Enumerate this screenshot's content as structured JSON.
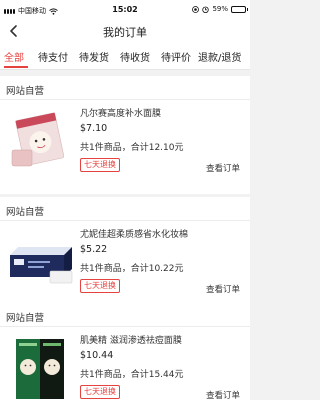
{
  "status_bar": {
    "carrier": "中国移动",
    "time": "15:02",
    "battery_text": "59%",
    "battery_level": 0.59
  },
  "nav": {
    "title": "我的订单"
  },
  "tabs": [
    {
      "label": "全部",
      "active": true
    },
    {
      "label": "待支付",
      "active": false
    },
    {
      "label": "待发货",
      "active": false
    },
    {
      "label": "待收货",
      "active": false
    },
    {
      "label": "待评价",
      "active": false
    },
    {
      "label": "退款/退货",
      "active": false
    }
  ],
  "orders": [
    {
      "shop": "网站自营",
      "product_name": "凡尔赛高度补水面膜",
      "price": "$7.10",
      "summary": "共1件商品，合计12.10元",
      "tag": "七天退换",
      "view_label": "查看订单"
    },
    {
      "shop": "网站自营",
      "product_name": "尤妮佳超柔质感省水化妆棉",
      "price": "$5.22",
      "summary": "共1件商品，合计10.22元",
      "tag": "七天退换",
      "view_label": "查看订单"
    },
    {
      "shop": "网站自营",
      "product_name": "肌美精 滋润渗透祛痘面膜",
      "price": "$10.44",
      "summary": "共1件商品，合计15.44元",
      "tag": "七天退换",
      "view_label": "查看订单"
    }
  ]
}
